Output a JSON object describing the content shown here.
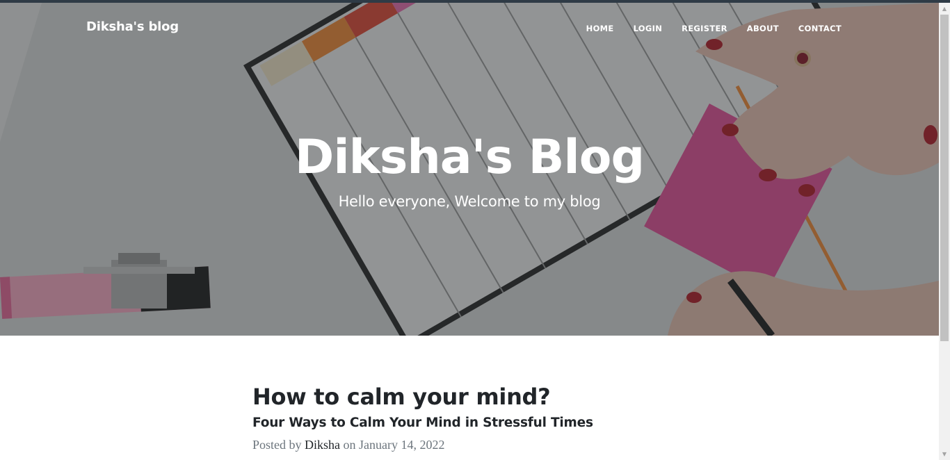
{
  "nav": {
    "brand": "Diksha's blog",
    "links": [
      {
        "label": "HOME"
      },
      {
        "label": "LOGIN"
      },
      {
        "label": "REGISTER"
      },
      {
        "label": "ABOUT"
      },
      {
        "label": "CONTACT"
      }
    ]
  },
  "hero": {
    "heading": "Diksha's Blog",
    "subheading": "Hello everyone, Welcome to my blog"
  },
  "posts": [
    {
      "title": "How to calm your mind?",
      "subtitle": "Four Ways to Calm Your Mind in Stressful Times",
      "meta_prefix": "Posted by",
      "author": "Diksha",
      "meta_on": "on January 14, 2022"
    }
  ],
  "colors": {
    "text_dark": "#212529",
    "meta_gray": "#6c757d",
    "sticky_note": "#e4539a",
    "nail_polish": "#b3202a"
  },
  "icons": {
    "scroll_up": "scroll-up-arrow-icon",
    "scroll_down": "scroll-down-arrow-icon"
  }
}
